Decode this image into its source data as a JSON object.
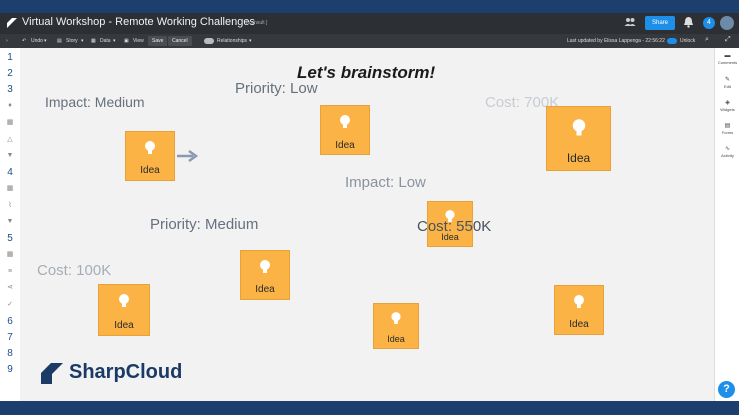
{
  "window": {
    "title": "Virtual Workshop - Remote Working Challenges",
    "subtitle": "[ consult ]",
    "share_label": "Share",
    "notification_count": "4"
  },
  "toolbar": {
    "undo": "Undo",
    "story": "Story",
    "data": "Data",
    "view": "View",
    "save": "Save",
    "cancel": "Cancel",
    "relationships": "Relationships",
    "last_updated": "Last updated by Elissa Lappenga - 22:56:22",
    "unlock": "Unlock"
  },
  "row_numbers": [
    "1",
    "2",
    "3",
    "4",
    "5",
    "6",
    "7",
    "8",
    "9"
  ],
  "right_panel": [
    {
      "label": "Comments",
      "icon": "comment-icon"
    },
    {
      "label": "Edit",
      "icon": "pencil-icon"
    },
    {
      "label": "Widgets",
      "icon": "cube-icon"
    },
    {
      "label": "Forms",
      "icon": "form-icon"
    },
    {
      "label": "Activity",
      "icon": "pulse-icon"
    }
  ],
  "canvas": {
    "headline": "Let's brainstorm!",
    "labels": {
      "impact_medium": "Impact: Medium",
      "priority_low": "Priority: Low",
      "cost_700k": "Cost: 700K",
      "impact_low": "Impact: Low",
      "priority_medium": "Priority: Medium",
      "cost_550k": "Cost: 550K",
      "cost_100k": "Cost: 100K"
    },
    "idea_label": "Idea"
  },
  "brand": {
    "name": "SharpCloud"
  },
  "colors": {
    "idea_card": "#fbb346",
    "accent": "#1e8fe8",
    "brand_navy": "#1b3b66",
    "label_gray": "#66707e"
  },
  "help": {
    "label": "?"
  }
}
